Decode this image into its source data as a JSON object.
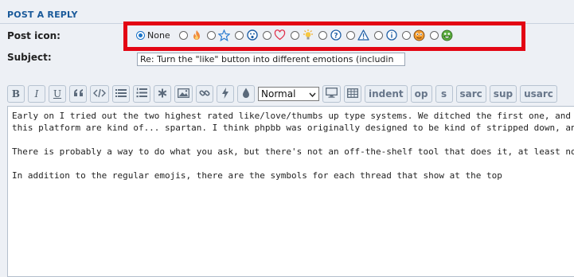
{
  "section": {
    "title": "POST A REPLY"
  },
  "post_icon": {
    "label": "Post icon:",
    "none_label": "None",
    "selected": "None",
    "icons": [
      "fire-icon",
      "star-icon",
      "surprised-face-icon",
      "heart-icon",
      "lightbulb-icon",
      "question-icon",
      "warning-icon",
      "info-icon",
      "orange-face-icon",
      "green-face-icon"
    ],
    "highlight_color": "#e30613"
  },
  "subject": {
    "label": "Subject:",
    "value": "Re: Turn the \"like\" button into different emotions (includin"
  },
  "toolbar": {
    "bold": "B",
    "italic": "I",
    "underline": "U",
    "font_size": "Normal",
    "indent": "indent",
    "op": "op",
    "s": "s",
    "sarc": "sarc",
    "sup": "sup",
    "usarc": "usarc"
  },
  "editor": {
    "lines": [
      "Early on I tried out the two highest rated like/love/thumbs up type systems. We ditched the first one, and this one has s",
      "this platform are kind of... spartan. I think phpbb was originally designed to be kind of stripped down, and it hasn't prog",
      "",
      "There is probably a way to do what you ask, but there's not an off-the-shelf tool that does it, at least not one that I've se",
      "",
      "In addition to the regular emojis, there are the symbols for each thread that show at the top"
    ]
  }
}
